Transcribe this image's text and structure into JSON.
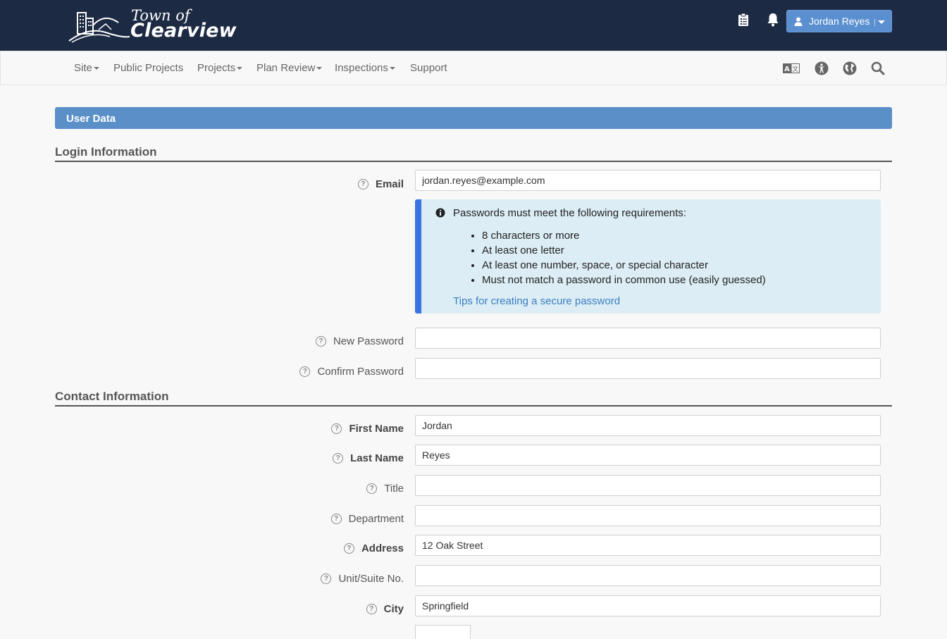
{
  "header": {
    "logo_top": "Town of",
    "logo_bottom": "Clearview",
    "user_name": "Jordan Reyes",
    "icons": [
      "clipboard-icon",
      "bell-icon",
      "user-icon"
    ]
  },
  "nav": {
    "items": [
      "Site",
      "Public Projects",
      "Projects",
      "Plan Review",
      "Inspections",
      "Support"
    ],
    "right_icons": [
      "translate-icon",
      "accessibility-icon",
      "globe-icon",
      "search-icon"
    ]
  },
  "panel": {
    "title": "User Data"
  },
  "login": {
    "section_title": "Login Information",
    "email_label": "Email",
    "email_value": "jordan.reyes@example.com",
    "password_note": {
      "message": "Passwords must meet the following requirements:",
      "requirements": [
        "8 characters or more",
        "At least one letter",
        "At least one number, space, or special character",
        "Must not match a password in common use (easily guessed)"
      ],
      "tips_link": "Tips for creating a secure password"
    },
    "new_password_label": "New Password",
    "confirm_password_label": "Confirm Password"
  },
  "contact": {
    "section_title": "Contact Information",
    "fields": [
      {
        "label": "First Name",
        "value": "Jordan"
      },
      {
        "label": "Last Name",
        "value": "Reyes"
      },
      {
        "label": "Title",
        "value": ""
      },
      {
        "label": "Department",
        "value": ""
      },
      {
        "label": "Address",
        "value": "12 Oak Street"
      },
      {
        "label": "Unit/Suite No.",
        "value": ""
      },
      {
        "label": "City",
        "value": "Springfield"
      }
    ]
  },
  "colors": {
    "header_bg": "#1c2a44",
    "accent": "#5a8fc8",
    "alert_bg": "#dcedf5",
    "alert_border": "#3b74e0",
    "link": "#3b7ec0"
  }
}
